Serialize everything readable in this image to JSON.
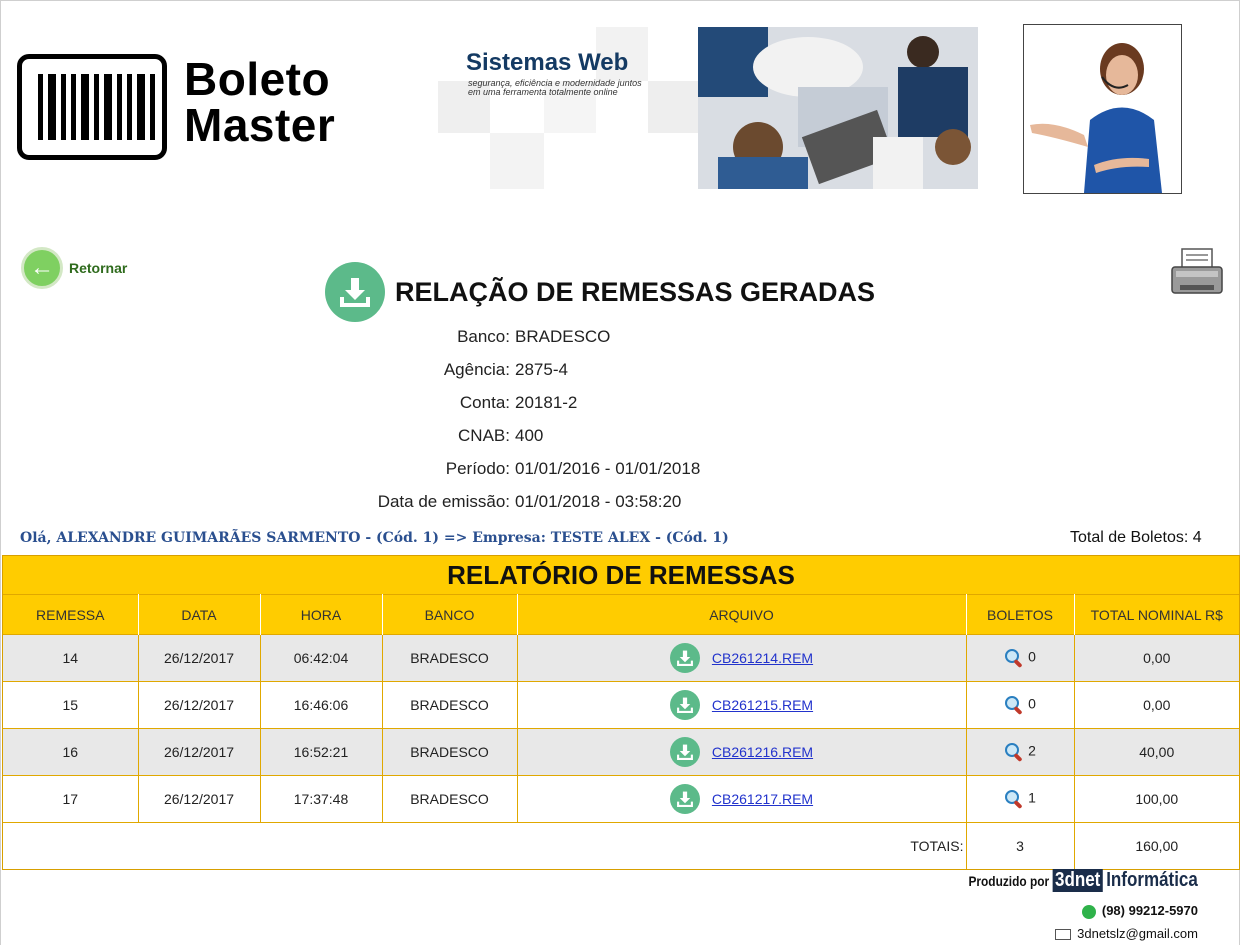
{
  "brand": {
    "logo_line1": "Boleto",
    "logo_line2": "Master"
  },
  "banner": {
    "title": "Sistemas Web",
    "subtitle": "segurança, eficiência e modernidade juntos em uma ferramenta totalmente online"
  },
  "nav": {
    "back_label": "Retornar"
  },
  "page": {
    "title": "RELAÇÃO DE REMESSAS GERADAS"
  },
  "info": [
    {
      "key": "Banco:",
      "value": "BRADESCO"
    },
    {
      "key": "Agência:",
      "value": "2875-4"
    },
    {
      "key": "Conta:",
      "value": "20181-2"
    },
    {
      "key": "CNAB:",
      "value": " 400"
    },
    {
      "key": "Período:",
      "value": "01/01/2016 - 01/01/2018"
    },
    {
      "key": "Data de emissão:",
      "value": "01/01/2018 - 03:58:20"
    }
  ],
  "greeting": "Olá, ALEXANDRE GUIMARÃES SARMENTO - (Cód. 1) => Empresa: TESTE ALEX - (Cód. 1)",
  "total_boletos": "Total de Boletos: 4",
  "report": {
    "title": "RELATÓRIO DE REMESSAS",
    "columns": [
      "REMESSA",
      "DATA",
      "HORA",
      "BANCO",
      "ARQUIVO",
      "BOLETOS",
      "TOTAL NOMINAL R$"
    ],
    "rows": [
      {
        "remessa": "14",
        "data": "26/12/2017",
        "hora": "06:42:04",
        "banco": "BRADESCO",
        "arquivo": "CB261214.REM",
        "boletos": "0",
        "total": "0,00"
      },
      {
        "remessa": "15",
        "data": "26/12/2017",
        "hora": "16:46:06",
        "banco": "BRADESCO",
        "arquivo": "CB261215.REM",
        "boletos": "0",
        "total": "0,00"
      },
      {
        "remessa": "16",
        "data": "26/12/2017",
        "hora": "16:52:21",
        "banco": "BRADESCO",
        "arquivo": "CB261216.REM",
        "boletos": "2",
        "total": "40,00"
      },
      {
        "remessa": "17",
        "data": "26/12/2017",
        "hora": "17:37:48",
        "banco": "BRADESCO",
        "arquivo": "CB261217.REM",
        "boletos": "1",
        "total": "100,00"
      }
    ],
    "totals_label": "TOTAIS:",
    "totals_boletos": "3",
    "totals_nominal": "160,00"
  },
  "footer": {
    "produced_by": "Produzido por",
    "company_box": "3dnet",
    "company_rest": "Informática",
    "phone": "(98) 99212-5970",
    "email": "3dnetslz@gmail.com"
  },
  "colors": {
    "header_yellow": "#ffcc00",
    "accent_green": "#5cba8a",
    "greeting_blue": "#2a4f8f"
  },
  "icons": [
    "barcode-logo-icon",
    "back-arrow-icon",
    "printer-icon",
    "download-icon",
    "magnifier-icon",
    "whatsapp-icon",
    "envelope-icon"
  ]
}
